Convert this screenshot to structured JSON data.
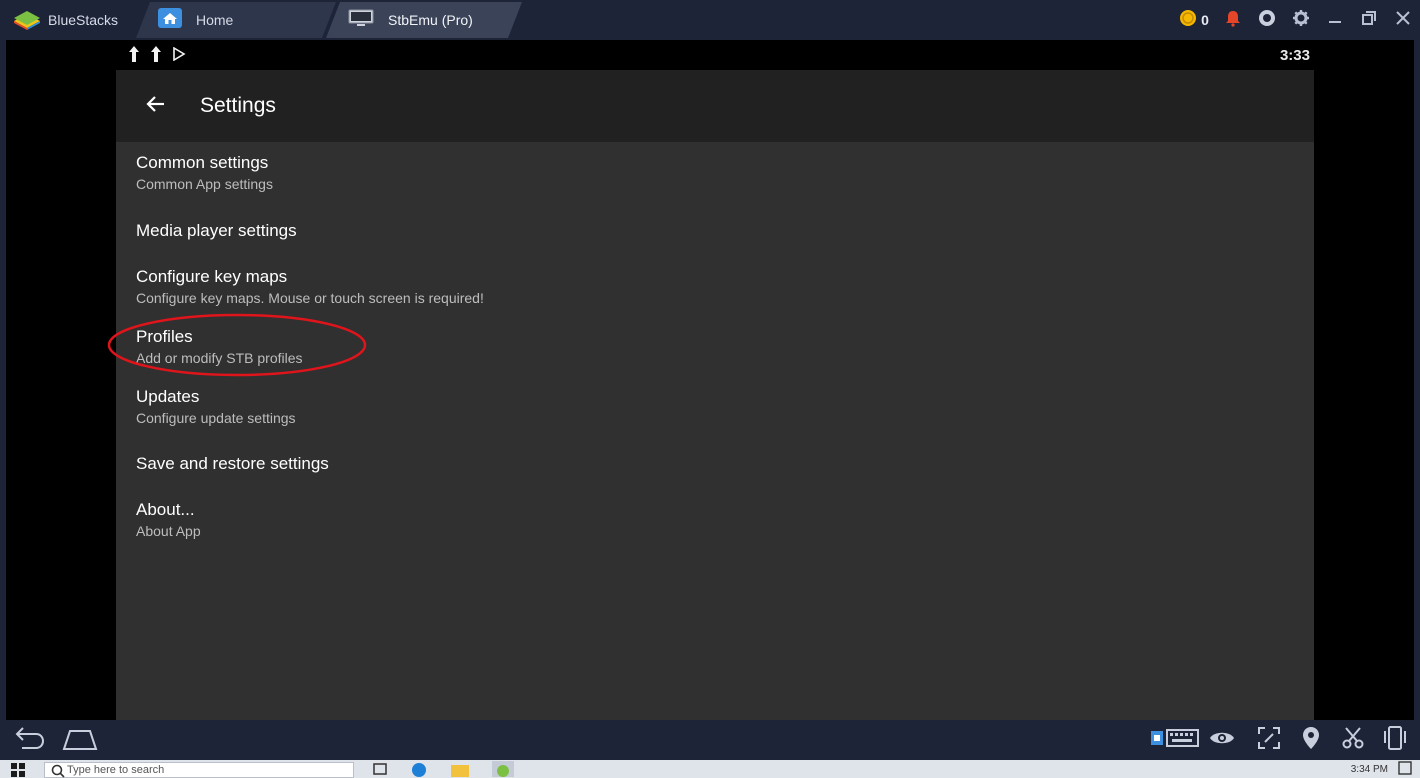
{
  "titlebar": {
    "brand": "BlueStacks",
    "tabs": [
      {
        "label": "Home",
        "icon": "home-icon"
      },
      {
        "label": "StbEmu (Pro)",
        "icon": "tv-icon"
      }
    ],
    "coin_count": "0"
  },
  "statusbar": {
    "time": "3:33"
  },
  "appbar": {
    "title": "Settings"
  },
  "settings": [
    {
      "title": "Common settings",
      "summary": "Common App settings"
    },
    {
      "title": "Media player settings",
      "summary": ""
    },
    {
      "title": "Configure key maps",
      "summary": "Configure key maps. Mouse or touch screen is required!"
    },
    {
      "title": "Profiles",
      "summary": "Add or modify STB profiles"
    },
    {
      "title": "Updates",
      "summary": "Configure update settings"
    },
    {
      "title": "Save and restore settings",
      "summary": ""
    },
    {
      "title": "About...",
      "summary": "About App"
    }
  ],
  "annotation": {
    "highlight_color": "#e0141b"
  },
  "taskbar": {
    "search_placeholder": "Type here to search",
    "clock_time": "3:34 PM"
  },
  "colors": {
    "titlebar": "#1d2438",
    "appbar": "#212121",
    "content": "#303030",
    "accent_coin": "#f5b800",
    "bell": "#e5462a"
  }
}
